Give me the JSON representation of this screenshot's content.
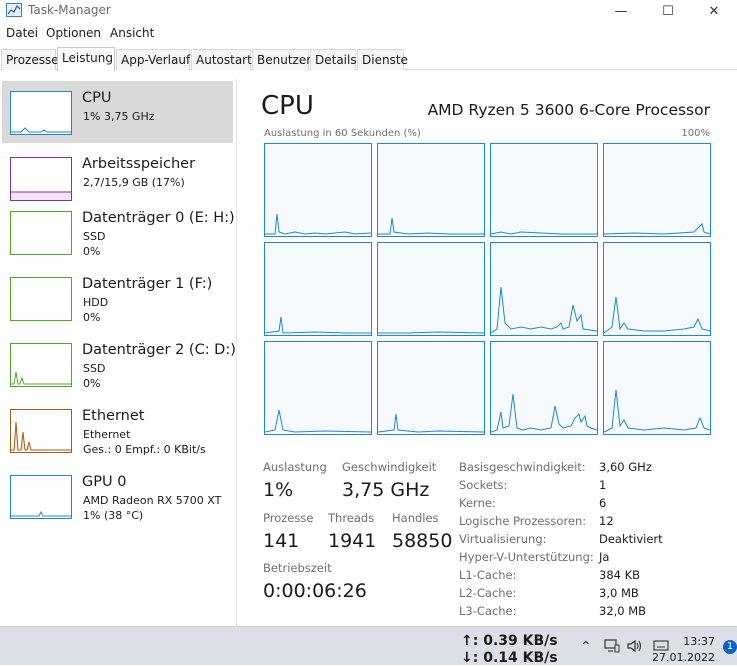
{
  "window": {
    "title": "Task-Manager",
    "minimize_glyph": "—",
    "maximize_glyph": "☐",
    "close_glyph": "✕"
  },
  "menu": [
    "Datei",
    "Optionen",
    "Ansicht"
  ],
  "tabs": [
    "Prozesse",
    "Leistung",
    "App-Verlauf",
    "Autostart",
    "Benutzer",
    "Details",
    "Dienste"
  ],
  "active_tab": "Leistung",
  "resources": [
    {
      "name": "CPU",
      "line1": "1% 3,75 GHz",
      "line2": "",
      "color": "#1d8ad0",
      "icon": "cpu-graph"
    },
    {
      "name": "Arbeitsspeicher",
      "line1": "2,7/15,9 GB (17%)",
      "line2": "",
      "color": "#8b2ba8",
      "icon": "memory-graph"
    },
    {
      "name": "Datenträger 0 (E: H:)",
      "line1": "SSD",
      "line2": "0%",
      "color": "#4fa82a",
      "icon": "disk-graph"
    },
    {
      "name": "Datenträger 1 (F:)",
      "line1": "HDD",
      "line2": "0%",
      "color": "#4fa82a",
      "icon": "disk-graph"
    },
    {
      "name": "Datenträger 2 (C: D:)",
      "line1": "SSD",
      "line2": "0%",
      "color": "#4fa82a",
      "icon": "disk-graph"
    },
    {
      "name": "Ethernet",
      "line1": "Ethernet",
      "line2": "Ges.: 0 Empf.: 0 KBit/s",
      "color": "#a75d14",
      "icon": "network-graph"
    },
    {
      "name": "GPU 0",
      "line1": "AMD Radeon RX 5700 XT",
      "line2": "1% (38 °C)",
      "color": "#1d8ad0",
      "icon": "gpu-graph"
    }
  ],
  "cpu": {
    "title": "CPU",
    "model": "AMD Ryzen 5 3600 6-Core Processor",
    "graph_caption": "Auslastung in 60 Sekunden (%)",
    "graph_max": "100%",
    "graph_color": "#1d8ad0",
    "cores": 12,
    "stats": {
      "auslastung_label": "Auslastung",
      "auslastung_value": "1%",
      "geschwindigkeit_label": "Geschwindigkeit",
      "geschwindigkeit_value": "3,75 GHz",
      "prozesse_label": "Prozesse",
      "prozesse_value": "141",
      "threads_label": "Threads",
      "threads_value": "1941",
      "handles_label": "Handles",
      "handles_value": "58850",
      "betriebszeit_label": "Betriebszeit",
      "betriebszeit_value": "0:00:06:26"
    },
    "details": [
      {
        "label": "Basisgeschwindigkeit:",
        "value": "3,60 GHz"
      },
      {
        "label": "Sockets:",
        "value": "1"
      },
      {
        "label": "Kerne:",
        "value": "6"
      },
      {
        "label": "Logische Prozessoren:",
        "value": "12"
      },
      {
        "label": "Virtualisierung:",
        "value": "Deaktiviert"
      },
      {
        "label": "Hyper-V-Unterstützung:",
        "value": "Ja"
      },
      {
        "label": "L1-Cache:",
        "value": "384 KB"
      },
      {
        "label": "L2-Cache:",
        "value": "3,0 MB"
      },
      {
        "label": "L3-Cache:",
        "value": "32,0 MB"
      }
    ]
  },
  "taskbar": {
    "upload": "↑: 0.39 KB/s",
    "download": "↓: 0.14 KB/s",
    "tray_icons": [
      "chevron-up-icon",
      "network-icon",
      "speaker-icon",
      "keyboard-icon"
    ],
    "time": "13:37",
    "date": "27.01.2022",
    "notification_count": "1"
  }
}
